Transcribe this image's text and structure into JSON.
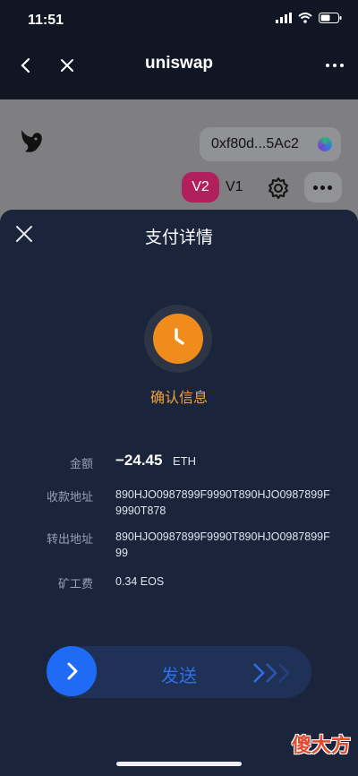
{
  "status_bar": {
    "time": "11:51"
  },
  "nav": {
    "title": "uniswap"
  },
  "uniswap": {
    "wallet_address": "0xf80d...5Ac2",
    "version_active": "V2",
    "version_other": "V1"
  },
  "sheet": {
    "title": "支付详情",
    "status_text": "确认信息",
    "rows": {
      "amount": {
        "label": "金额",
        "value": "−24.45",
        "unit": "ETH"
      },
      "receiver": {
        "label": "收款地址",
        "value": "890HJO0987899F9990T890HJO0987899F9990T878"
      },
      "sender": {
        "label": "转出地址",
        "value": "890HJO0987899F9990T890HJO0987899F99"
      },
      "fee": {
        "label": "矿工费",
        "value": "0.34 EOS"
      }
    },
    "slider_label": "发送"
  },
  "watermark": "傻大方",
  "colors": {
    "accent_orange": "#f08c1c",
    "accent_blue": "#1f6bf5",
    "sheet_bg": "#1a243a",
    "v2_pink": "#b0205c"
  }
}
